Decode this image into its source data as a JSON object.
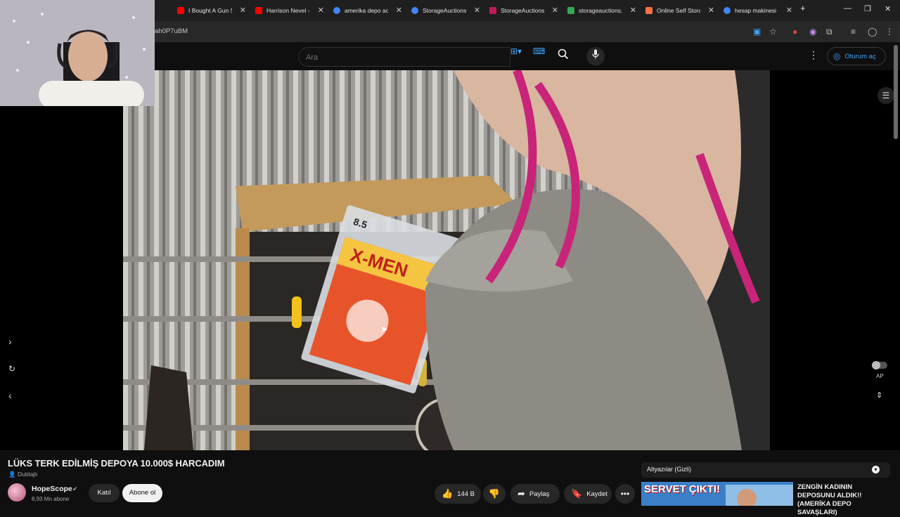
{
  "browser": {
    "tabs": [
      {
        "title": "I Bought A Gun S",
        "color": "#ff0000"
      },
      {
        "title": "Harrison Nevel - Y",
        "color": "#ff0000"
      },
      {
        "title": "amerika depo acil",
        "color": "#4285f4"
      },
      {
        "title": "StorageAuctions",
        "color": "#4285f4"
      },
      {
        "title": "StorageAuctions.c",
        "color": "#c2185b"
      },
      {
        "title": "storageauctions.c",
        "color": "#34a853"
      },
      {
        "title": "Online Self Storag",
        "color": "#ff7043"
      },
      {
        "title": "hesap makinesi -",
        "color": "#4285f4"
      }
    ],
    "new_tab": "+",
    "url": "ah0P7uBM"
  },
  "header": {
    "search_placeholder": "Ara",
    "sign_in": "Oturum aç"
  },
  "video": {
    "title": "LÜKS TERK EDİLMİŞ DEPOYA 10.000$ HARCADIM",
    "dubbed": "Dublajlı",
    "autoplay_label": "AP"
  },
  "channel": {
    "name": "HopeScope",
    "subscribers": "8,93 Mn abone",
    "join": "Katıl",
    "subscribe": "Abone ol"
  },
  "actions": {
    "likes": "144 B",
    "share": "Paylaş",
    "save": "Kaydet"
  },
  "sidebar": {
    "subtitles": "Altyazılar (Gizli)",
    "rec_title": "ZENGİN KADININ DEPOSUNU ALDIK!! (AMERİKA DEPO SAVAŞLARI)",
    "thumb_text": "SERVET ÇIKTI!"
  }
}
